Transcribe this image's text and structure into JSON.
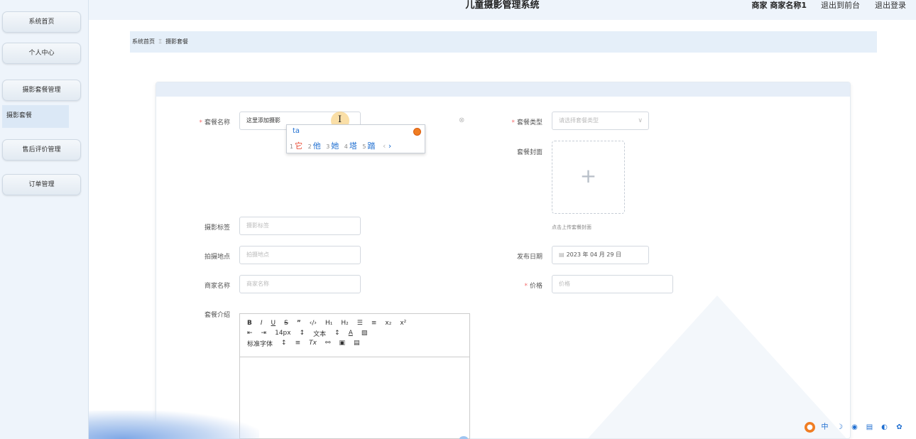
{
  "header": {
    "title": "儿童摄影管理系统",
    "user": "商家 商家名称1",
    "frontend_link": "退出到前台",
    "logout_link": "退出登录"
  },
  "sidebar": {
    "items": [
      "系统首页",
      "个人中心",
      "摄影套餐管理",
      "售后评价管理",
      "订单管理"
    ],
    "submenu": [
      "摄影套餐"
    ]
  },
  "breadcrumb": {
    "home": "系统首页",
    "separator": "Ξ",
    "current": "摄影套餐"
  },
  "form": {
    "name": {
      "label": "套餐名称",
      "value": "这里添加摄影"
    },
    "type": {
      "label": "套餐类型",
      "placeholder": "请选择套餐类型"
    },
    "cover": {
      "label": "套餐封面",
      "tip": "点击上传套餐封面"
    },
    "tags": {
      "label": "摄影标签",
      "placeholder": "摄影标签"
    },
    "location": {
      "label": "拍摄地点",
      "placeholder": "拍摄地点"
    },
    "date": {
      "label": "发布日期",
      "value": "2023 年 04 月 29 日"
    },
    "merchant": {
      "label": "商家名称",
      "placeholder": "商家名称"
    },
    "price": {
      "label": "价格",
      "placeholder": "价格"
    },
    "intro": {
      "label": "套餐介绍"
    }
  },
  "ime": {
    "typed": "ta",
    "candidates": [
      {
        "num": "1",
        "text": "它"
      },
      {
        "num": "2",
        "text": "他"
      },
      {
        "num": "3",
        "text": "她"
      },
      {
        "num": "4",
        "text": "塔"
      },
      {
        "num": "5",
        "text": "踏"
      }
    ]
  },
  "editor": {
    "row1": [
      "B",
      "I",
      "U",
      "S",
      "”",
      "‹/›",
      "H₁",
      "H₂",
      "☰",
      "≡",
      "x₂",
      "x²"
    ],
    "row2": [
      "⇤",
      "⇥",
      "14px",
      "↕",
      "文本",
      "↕",
      "A",
      "▧"
    ],
    "row3": [
      "标准字体",
      "↕",
      "≡",
      "Tx",
      "⚯",
      "▣",
      "▤"
    ]
  },
  "icons": {
    "clear": "circle-x-icon",
    "calendar": "calendar-icon",
    "upload": "plus-icon",
    "chevron": "chevron-down-icon"
  },
  "colors": {
    "required": "#f56c6c",
    "ime_highlight": "#e8432c",
    "ime_text": "#1f6fd1"
  }
}
